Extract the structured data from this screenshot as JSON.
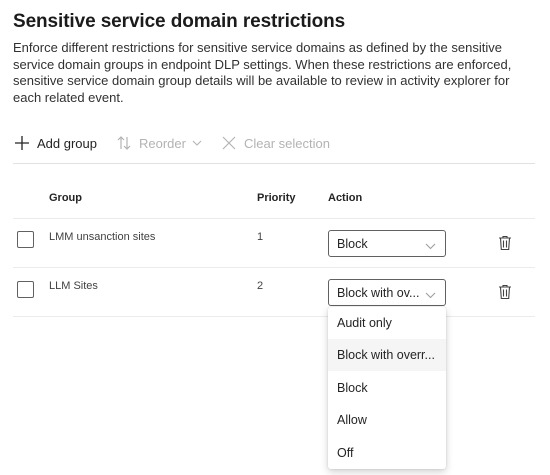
{
  "page": {
    "title": "Sensitive service domain restrictions",
    "description": "Enforce different restrictions for sensitive service domains as defined by the sensitive service domain groups in endpoint DLP settings. When these restrictions are enforced, sensitive service domain group details will be available to review in activity explorer for each related event."
  },
  "toolbar": {
    "add_label": "Add group",
    "reorder_label": "Reorder",
    "clear_label": "Clear selection"
  },
  "table": {
    "headers": {
      "group": "Group",
      "priority": "Priority",
      "action": "Action"
    },
    "rows": [
      {
        "group": "LMM unsanction sites",
        "priority": "1",
        "action": "Block"
      },
      {
        "group": "LLM Sites",
        "priority": "2",
        "action": "Block with ov..."
      }
    ]
  },
  "dropdown": {
    "options": [
      "Audit only",
      "Block with overr...",
      "Block",
      "Allow",
      "Off"
    ],
    "highlighted_index": 1
  },
  "colors": {
    "text": "#242424",
    "disabled": "#b3b3b3",
    "border": "#616161",
    "hover": "#f5f5f5"
  }
}
